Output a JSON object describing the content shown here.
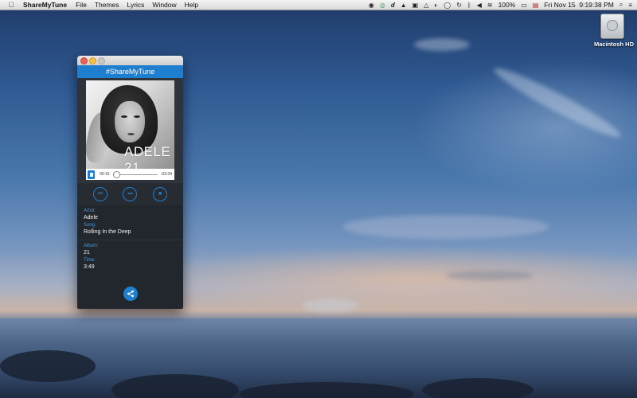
{
  "menubar": {
    "apple_icon": "apple-icon",
    "app_name": "ShareMyTune",
    "menus": [
      "File",
      "Themes",
      "Lyrics",
      "Window",
      "Help"
    ],
    "status": {
      "battery": "100%",
      "datetime": "Fri Nov 15  9:19:38 PM",
      "icons": [
        "record-icon",
        "sync-icon",
        "dash-icon",
        "hat-icon",
        "docker-icon",
        "drive-icon",
        "eye-icon",
        "chat-icon",
        "timemachine-icon",
        "bluetooth-icon",
        "volume-icon",
        "wifi-icon",
        "flag-icon",
        "search-icon",
        "list-icon"
      ]
    }
  },
  "desktop": {
    "drive_label": "Macintosh HD"
  },
  "app": {
    "header_title": "#ShareMyTune",
    "album_art_text": "ADELE 21",
    "player": {
      "elapsed": "00:15",
      "remaining": "-03:34",
      "progress_fraction": 0.07
    },
    "controls": {
      "previous": "⏮",
      "next": "⏭",
      "stop": "■"
    },
    "info": {
      "artist_label": "Artist:",
      "artist": "Adele",
      "song_label": "Song:",
      "song": "Rolling In the Deep",
      "album_label": "Album:",
      "album": "21",
      "time_label": "Time:",
      "time": "3:49"
    },
    "share_icon": "share-icon"
  },
  "colors": {
    "accent": "#1e7fd0",
    "window_bg": "#22262d"
  }
}
